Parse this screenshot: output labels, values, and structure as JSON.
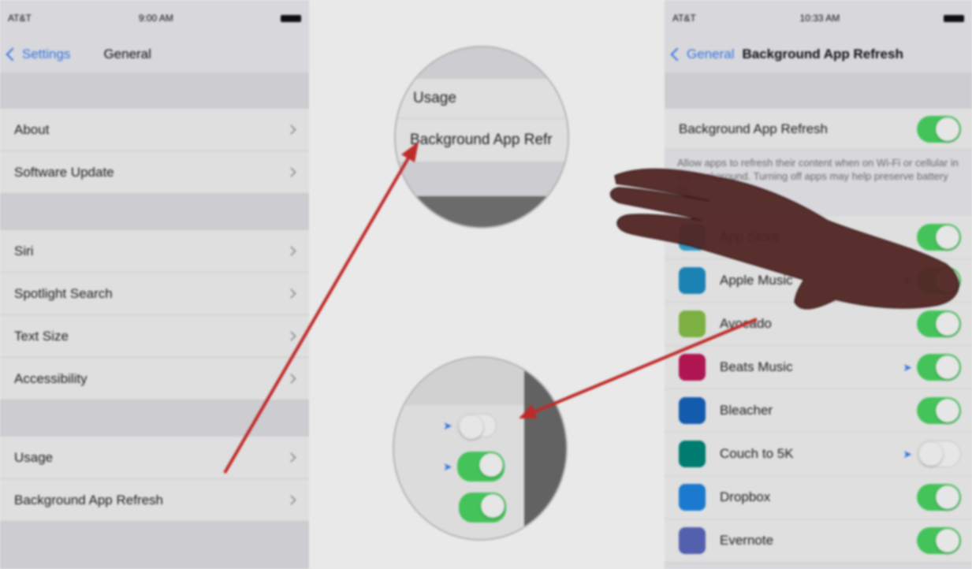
{
  "left_phone": {
    "status": {
      "carrier": "AT&T",
      "time": "9:00 AM"
    },
    "nav": {
      "back_label": "Settings",
      "title": "General"
    },
    "rows": [
      {
        "label": "About"
      },
      {
        "label": "Software Update"
      },
      {
        "label": "Siri"
      },
      {
        "label": "Spotlight Search"
      },
      {
        "label": "Text Size"
      },
      {
        "label": "Accessibility"
      },
      {
        "label": "Usage"
      },
      {
        "label": "Background App Refresh"
      }
    ]
  },
  "magnifier_top": {
    "line1": "Usage",
    "line2": "Background App Refr"
  },
  "right_phone": {
    "status": {
      "carrier": "AT&T",
      "time": "10:33 AM"
    },
    "nav": {
      "back_label": "General",
      "title": "Background App Refresh"
    },
    "master_label": "Background App Refresh",
    "description": "Allow apps to refresh their content when on Wi-Fi or cellular in the background. Turning off apps may help preserve battery life.",
    "apps": [
      {
        "name": "App Store",
        "icon": "app-store-icon",
        "color": "#34aadc",
        "location": false,
        "enabled": true
      },
      {
        "name": "Apple Music",
        "icon": "music-icon",
        "color": "#1e90c8",
        "location": true,
        "enabled": true
      },
      {
        "name": "Avocado",
        "icon": "avocado-icon",
        "color": "#8bc34a",
        "location": false,
        "enabled": true
      },
      {
        "name": "Beats Music",
        "icon": "beats-icon",
        "color": "#c2185b",
        "location": true,
        "enabled": true
      },
      {
        "name": "Bleacher",
        "icon": "bleacher-icon",
        "color": "#1565c0",
        "location": false,
        "enabled": true
      },
      {
        "name": "Couch to 5K",
        "icon": "runner-icon",
        "color": "#00897b",
        "location": true,
        "enabled": false
      },
      {
        "name": "Dropbox",
        "icon": "dropbox-icon",
        "color": "#1e88e5",
        "location": false,
        "enabled": true
      },
      {
        "name": "Evernote",
        "icon": "evernote-icon",
        "color": "#5c6bc0",
        "location": false,
        "enabled": true
      }
    ]
  },
  "colors": {
    "toggle_on": "#4cd964",
    "accent_blue": "#3b82f6",
    "arrow_red": "#d32f2f",
    "hand": "#5a2a28"
  }
}
